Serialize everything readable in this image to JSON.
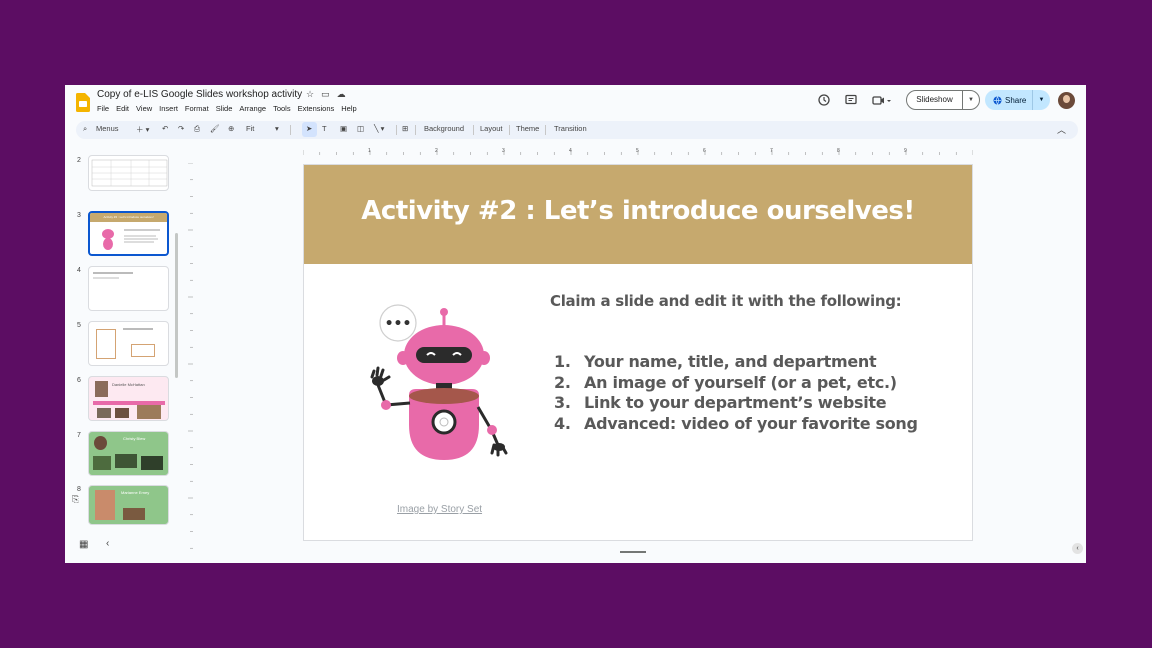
{
  "app": {
    "doc_title": "Copy of e-LIS Google Slides workshop activity",
    "menu": [
      "File",
      "Edit",
      "View",
      "Insert",
      "Format",
      "Slide",
      "Arrange",
      "Tools",
      "Extensions",
      "Help"
    ],
    "slideshow_label": "Slideshow",
    "share_label": "Share"
  },
  "toolbar": {
    "menus_label": "Menus",
    "zoom_label": "Fit",
    "background_label": "Background",
    "layout_label": "Layout",
    "theme_label": "Theme",
    "transition_label": "Transition"
  },
  "filmstrip": {
    "slide_numbers": [
      "2",
      "3",
      "4",
      "5",
      "6",
      "7",
      "8"
    ],
    "active_slide": "3",
    "thumb_titles": {
      "s3": "Activity #2 : Let's introduce ourselves!",
      "s6": "Danielle McHattan",
      "s7": "Christy Blew",
      "s8": "Marianne Erney"
    }
  },
  "slide": {
    "title": "Activity #2 : Let’s introduce ourselves!",
    "intro": "Claim a slide and edit it with the following:",
    "list": [
      {
        "n": "1.",
        "text": "Your name, title, and department"
      },
      {
        "n": "2.",
        "text": "An image of yourself (or a pet, etc.)"
      },
      {
        "n": "3.",
        "text": "Link to your department’s website"
      },
      {
        "n": "4.",
        "text": "Advanced: video of your favorite song"
      }
    ],
    "credit": "Image by Story Set",
    "speech_bubble": "•••"
  },
  "ruler_labels": [
    "1",
    "2",
    "3",
    "4",
    "5",
    "6",
    "7",
    "8",
    "9"
  ],
  "colors": {
    "background": "#5c0d63",
    "banner": "#c6a96e",
    "body_text": "#595959",
    "robot_pink": "#e86aa9",
    "accent_blue": "#0b57d0",
    "share_bg": "#c2e7ff"
  }
}
